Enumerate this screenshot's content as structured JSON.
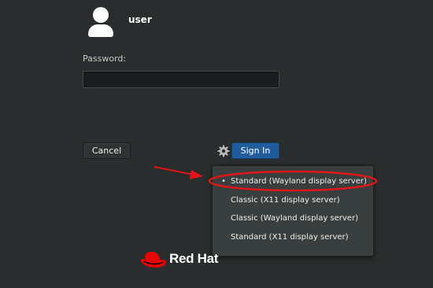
{
  "user": {
    "name": "user"
  },
  "password": {
    "label": "Password:",
    "value": ""
  },
  "buttons": {
    "cancel": "Cancel",
    "sign_in": "Sign In"
  },
  "session_menu": {
    "items": [
      {
        "label": "Standard (Wayland display server)",
        "selected": true
      },
      {
        "label": "Classic (X11 display server)",
        "selected": false
      },
      {
        "label": "Classic (Wayland display server)",
        "selected": false
      },
      {
        "label": "Standard (X11 display server)",
        "selected": false
      }
    ],
    "selected_bullet": "•"
  },
  "annotation": {
    "color": "#e3131b"
  },
  "branding": {
    "name": "Red Hat",
    "color": "#ee0000"
  },
  "icons": {
    "settings": "gear-icon",
    "avatar": "avatar-icon"
  }
}
